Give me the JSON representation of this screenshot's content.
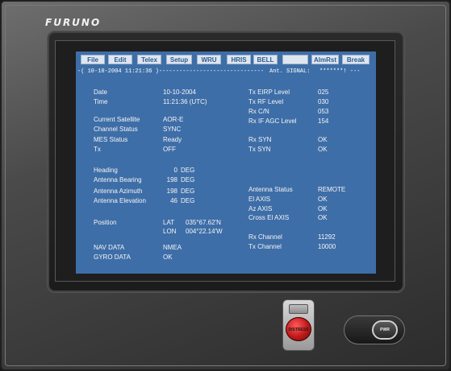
{
  "brand": "FURUNO",
  "menu": [
    {
      "key": "file",
      "label": "File"
    },
    {
      "key": "edit",
      "label": "Edit"
    },
    {
      "key": "telex",
      "label": "Telex"
    },
    {
      "key": "setup",
      "label": "Setup"
    },
    {
      "key": "wru",
      "label": "WRU"
    },
    {
      "key": "hris",
      "label": "HRIS"
    },
    {
      "key": "bell",
      "label": "BELL"
    },
    {
      "key": "blank",
      "label": ""
    },
    {
      "key": "almrst",
      "label": "AlmRst"
    },
    {
      "key": "break",
      "label": "Break"
    }
  ],
  "status_bar": {
    "left": "-( 10-10-2004  11:21:36 )-------------------------------",
    "signal_label": "Ant. SIGNAL:",
    "signal_value": "*******! ---"
  },
  "left_panel": {
    "date_label": "Date",
    "date_value": "10-10-2004",
    "time_label": "Time",
    "time_value": "11:21:36 (UTC)",
    "current_satellite_label": "Current Satellite",
    "current_satellite_value": "AOR-E",
    "channel_status_label": "Channel Status",
    "channel_status_value": "SYNC",
    "mes_status_label": "MES Status",
    "mes_status_value": "Ready",
    "tx_label": "Tx",
    "tx_value": "OFF",
    "heading_label": "Heading",
    "heading_value": "0",
    "antenna_bearing_label": "Antenna Bearing",
    "antenna_bearing_value": "198",
    "antenna_azimuth_label": "Antenna Azimuth",
    "antenna_azimuth_value": "198",
    "antenna_elevation_label": "Antenna Elevation",
    "antenna_elevation_value": "46",
    "deg_unit": "DEG",
    "position_label": "Position",
    "lat_label": "LAT",
    "lat_value": "035°67.62'N",
    "lon_label": "LON",
    "lon_value": "004°22.14'W",
    "nav_data_label": "NAV DATA",
    "nav_data_value": "NMEA",
    "gyro_data_label": "GYRO DATA",
    "gyro_data_value": "OK"
  },
  "right_panel": {
    "tx_eirp_label": "Tx EIRP Level",
    "tx_eirp_value": "025",
    "tx_rf_label": "Tx RF Level",
    "tx_rf_value": "030",
    "rx_cn_label": "Rx C/N",
    "rx_cn_value": "053",
    "rx_if_agc_label": "Rx IF AGC Level",
    "rx_if_agc_value": "154",
    "rx_syn_label": "Rx SYN",
    "rx_syn_value": "OK",
    "tx_syn_label": "Tx SYN",
    "tx_syn_value": "OK",
    "antenna_status_label": "Antenna Status",
    "antenna_status_value": "REMOTE",
    "el_axis_label": "El AXIS",
    "el_axis_value": "OK",
    "az_axis_label": "Az AXIS",
    "az_axis_value": "OK",
    "cross_el_axis_label": "Cross El AXIS",
    "cross_el_axis_value": "OK",
    "rx_channel_label": "Rx Channel",
    "rx_channel_value": "11292",
    "tx_channel_label": "Tx Channel",
    "tx_channel_value": "10000"
  },
  "hardware": {
    "distress_label": "DISTRESS",
    "pwr_label": "PWR"
  },
  "colors": {
    "screen_bg": "#3e6ea8",
    "menu_button_bg": "#dfe6ef",
    "menu_button_text": "#2d5a94",
    "distress_red": "#c01818"
  }
}
